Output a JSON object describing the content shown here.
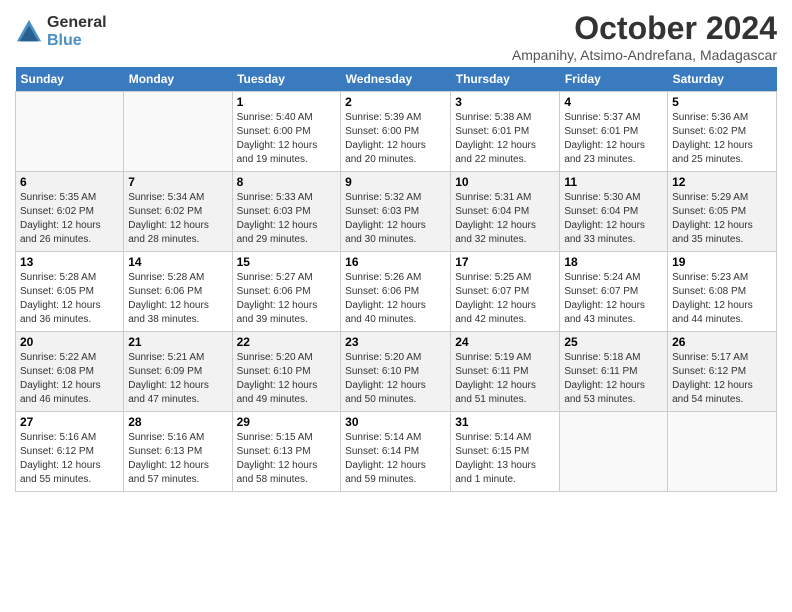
{
  "logo": {
    "general": "General",
    "blue": "Blue"
  },
  "header": {
    "month": "October 2024",
    "subtitle": "Ampanihy, Atsimo-Andrefana, Madagascar"
  },
  "weekdays": [
    "Sunday",
    "Monday",
    "Tuesday",
    "Wednesday",
    "Thursday",
    "Friday",
    "Saturday"
  ],
  "weeks": [
    [
      {
        "day": "",
        "info": ""
      },
      {
        "day": "",
        "info": ""
      },
      {
        "day": "1",
        "info": "Sunrise: 5:40 AM\nSunset: 6:00 PM\nDaylight: 12 hours\nand 19 minutes."
      },
      {
        "day": "2",
        "info": "Sunrise: 5:39 AM\nSunset: 6:00 PM\nDaylight: 12 hours\nand 20 minutes."
      },
      {
        "day": "3",
        "info": "Sunrise: 5:38 AM\nSunset: 6:01 PM\nDaylight: 12 hours\nand 22 minutes."
      },
      {
        "day": "4",
        "info": "Sunrise: 5:37 AM\nSunset: 6:01 PM\nDaylight: 12 hours\nand 23 minutes."
      },
      {
        "day": "5",
        "info": "Sunrise: 5:36 AM\nSunset: 6:02 PM\nDaylight: 12 hours\nand 25 minutes."
      }
    ],
    [
      {
        "day": "6",
        "info": "Sunrise: 5:35 AM\nSunset: 6:02 PM\nDaylight: 12 hours\nand 26 minutes."
      },
      {
        "day": "7",
        "info": "Sunrise: 5:34 AM\nSunset: 6:02 PM\nDaylight: 12 hours\nand 28 minutes."
      },
      {
        "day": "8",
        "info": "Sunrise: 5:33 AM\nSunset: 6:03 PM\nDaylight: 12 hours\nand 29 minutes."
      },
      {
        "day": "9",
        "info": "Sunrise: 5:32 AM\nSunset: 6:03 PM\nDaylight: 12 hours\nand 30 minutes."
      },
      {
        "day": "10",
        "info": "Sunrise: 5:31 AM\nSunset: 6:04 PM\nDaylight: 12 hours\nand 32 minutes."
      },
      {
        "day": "11",
        "info": "Sunrise: 5:30 AM\nSunset: 6:04 PM\nDaylight: 12 hours\nand 33 minutes."
      },
      {
        "day": "12",
        "info": "Sunrise: 5:29 AM\nSunset: 6:05 PM\nDaylight: 12 hours\nand 35 minutes."
      }
    ],
    [
      {
        "day": "13",
        "info": "Sunrise: 5:28 AM\nSunset: 6:05 PM\nDaylight: 12 hours\nand 36 minutes."
      },
      {
        "day": "14",
        "info": "Sunrise: 5:28 AM\nSunset: 6:06 PM\nDaylight: 12 hours\nand 38 minutes."
      },
      {
        "day": "15",
        "info": "Sunrise: 5:27 AM\nSunset: 6:06 PM\nDaylight: 12 hours\nand 39 minutes."
      },
      {
        "day": "16",
        "info": "Sunrise: 5:26 AM\nSunset: 6:06 PM\nDaylight: 12 hours\nand 40 minutes."
      },
      {
        "day": "17",
        "info": "Sunrise: 5:25 AM\nSunset: 6:07 PM\nDaylight: 12 hours\nand 42 minutes."
      },
      {
        "day": "18",
        "info": "Sunrise: 5:24 AM\nSunset: 6:07 PM\nDaylight: 12 hours\nand 43 minutes."
      },
      {
        "day": "19",
        "info": "Sunrise: 5:23 AM\nSunset: 6:08 PM\nDaylight: 12 hours\nand 44 minutes."
      }
    ],
    [
      {
        "day": "20",
        "info": "Sunrise: 5:22 AM\nSunset: 6:08 PM\nDaylight: 12 hours\nand 46 minutes."
      },
      {
        "day": "21",
        "info": "Sunrise: 5:21 AM\nSunset: 6:09 PM\nDaylight: 12 hours\nand 47 minutes."
      },
      {
        "day": "22",
        "info": "Sunrise: 5:20 AM\nSunset: 6:10 PM\nDaylight: 12 hours\nand 49 minutes."
      },
      {
        "day": "23",
        "info": "Sunrise: 5:20 AM\nSunset: 6:10 PM\nDaylight: 12 hours\nand 50 minutes."
      },
      {
        "day": "24",
        "info": "Sunrise: 5:19 AM\nSunset: 6:11 PM\nDaylight: 12 hours\nand 51 minutes."
      },
      {
        "day": "25",
        "info": "Sunrise: 5:18 AM\nSunset: 6:11 PM\nDaylight: 12 hours\nand 53 minutes."
      },
      {
        "day": "26",
        "info": "Sunrise: 5:17 AM\nSunset: 6:12 PM\nDaylight: 12 hours\nand 54 minutes."
      }
    ],
    [
      {
        "day": "27",
        "info": "Sunrise: 5:16 AM\nSunset: 6:12 PM\nDaylight: 12 hours\nand 55 minutes."
      },
      {
        "day": "28",
        "info": "Sunrise: 5:16 AM\nSunset: 6:13 PM\nDaylight: 12 hours\nand 57 minutes."
      },
      {
        "day": "29",
        "info": "Sunrise: 5:15 AM\nSunset: 6:13 PM\nDaylight: 12 hours\nand 58 minutes."
      },
      {
        "day": "30",
        "info": "Sunrise: 5:14 AM\nSunset: 6:14 PM\nDaylight: 12 hours\nand 59 minutes."
      },
      {
        "day": "31",
        "info": "Sunrise: 5:14 AM\nSunset: 6:15 PM\nDaylight: 13 hours\nand 1 minute."
      },
      {
        "day": "",
        "info": ""
      },
      {
        "day": "",
        "info": ""
      }
    ]
  ]
}
